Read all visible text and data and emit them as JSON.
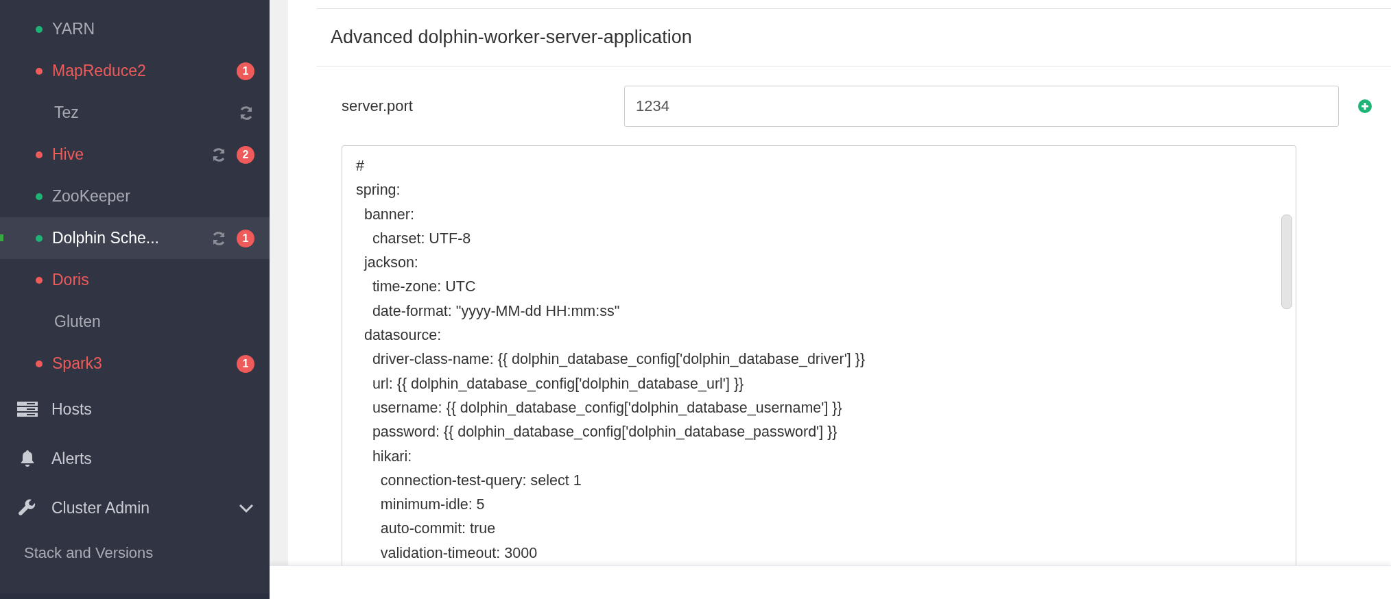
{
  "sidebar": {
    "services": [
      {
        "label": "YARN",
        "color": "#1eb475",
        "alert": false,
        "selected": false,
        "restart": false
      },
      {
        "label": "MapReduce2",
        "color": "#ef5a5a",
        "alert": true,
        "selected": false,
        "restart": false,
        "badge": "1"
      },
      {
        "label": "Tez",
        "alert": false,
        "selected": false,
        "restart": true
      },
      {
        "label": "Hive",
        "color": "#ef5a5a",
        "alert": true,
        "selected": false,
        "restart": true,
        "badge": "2"
      },
      {
        "label": "ZooKeeper",
        "color": "#1eb475",
        "alert": false,
        "selected": false,
        "restart": false
      },
      {
        "label": "Dolphin Sche...",
        "color": "#1eb475",
        "alert": false,
        "selected": true,
        "restart": true,
        "badge": "1"
      },
      {
        "label": "Doris",
        "color": "#ef5a5a",
        "alert": true,
        "selected": false,
        "restart": false
      },
      {
        "label": "Gluten",
        "alert": false,
        "selected": false,
        "restart": false
      },
      {
        "label": "Spark3",
        "color": "#ef5a5a",
        "alert": true,
        "selected": false,
        "restart": false,
        "badge": "1"
      }
    ],
    "nav": [
      {
        "label": "Hosts",
        "kind": "hosts"
      },
      {
        "label": "Alerts",
        "kind": "alerts"
      },
      {
        "label": "Cluster Admin",
        "kind": "admin",
        "expanded": true
      }
    ],
    "subitems": [
      "Stack and Versions"
    ]
  },
  "section": {
    "title": "Advanced dolphin-worker-server-application",
    "property": {
      "label": "server.port",
      "value": "1234"
    },
    "content_lines": [
      "#",
      "spring:",
      "  banner:",
      "    charset: UTF-8",
      "  jackson:",
      "    time-zone: UTC",
      "    date-format: \"yyyy-MM-dd HH:mm:ss\"",
      "  datasource:",
      "    driver-class-name: {{ dolphin_database_config['dolphin_database_driver'] }}",
      "    url: {{ dolphin_database_config['dolphin_database_url'] }}",
      "    username: {{ dolphin_database_config['dolphin_database_username'] }}",
      "    password: {{ dolphin_database_config['dolphin_database_password'] }}",
      "    hikari:",
      "      connection-test-query: select 1",
      "      minimum-idle: 5",
      "      auto-commit: true",
      "      validation-timeout: 3000"
    ]
  }
}
